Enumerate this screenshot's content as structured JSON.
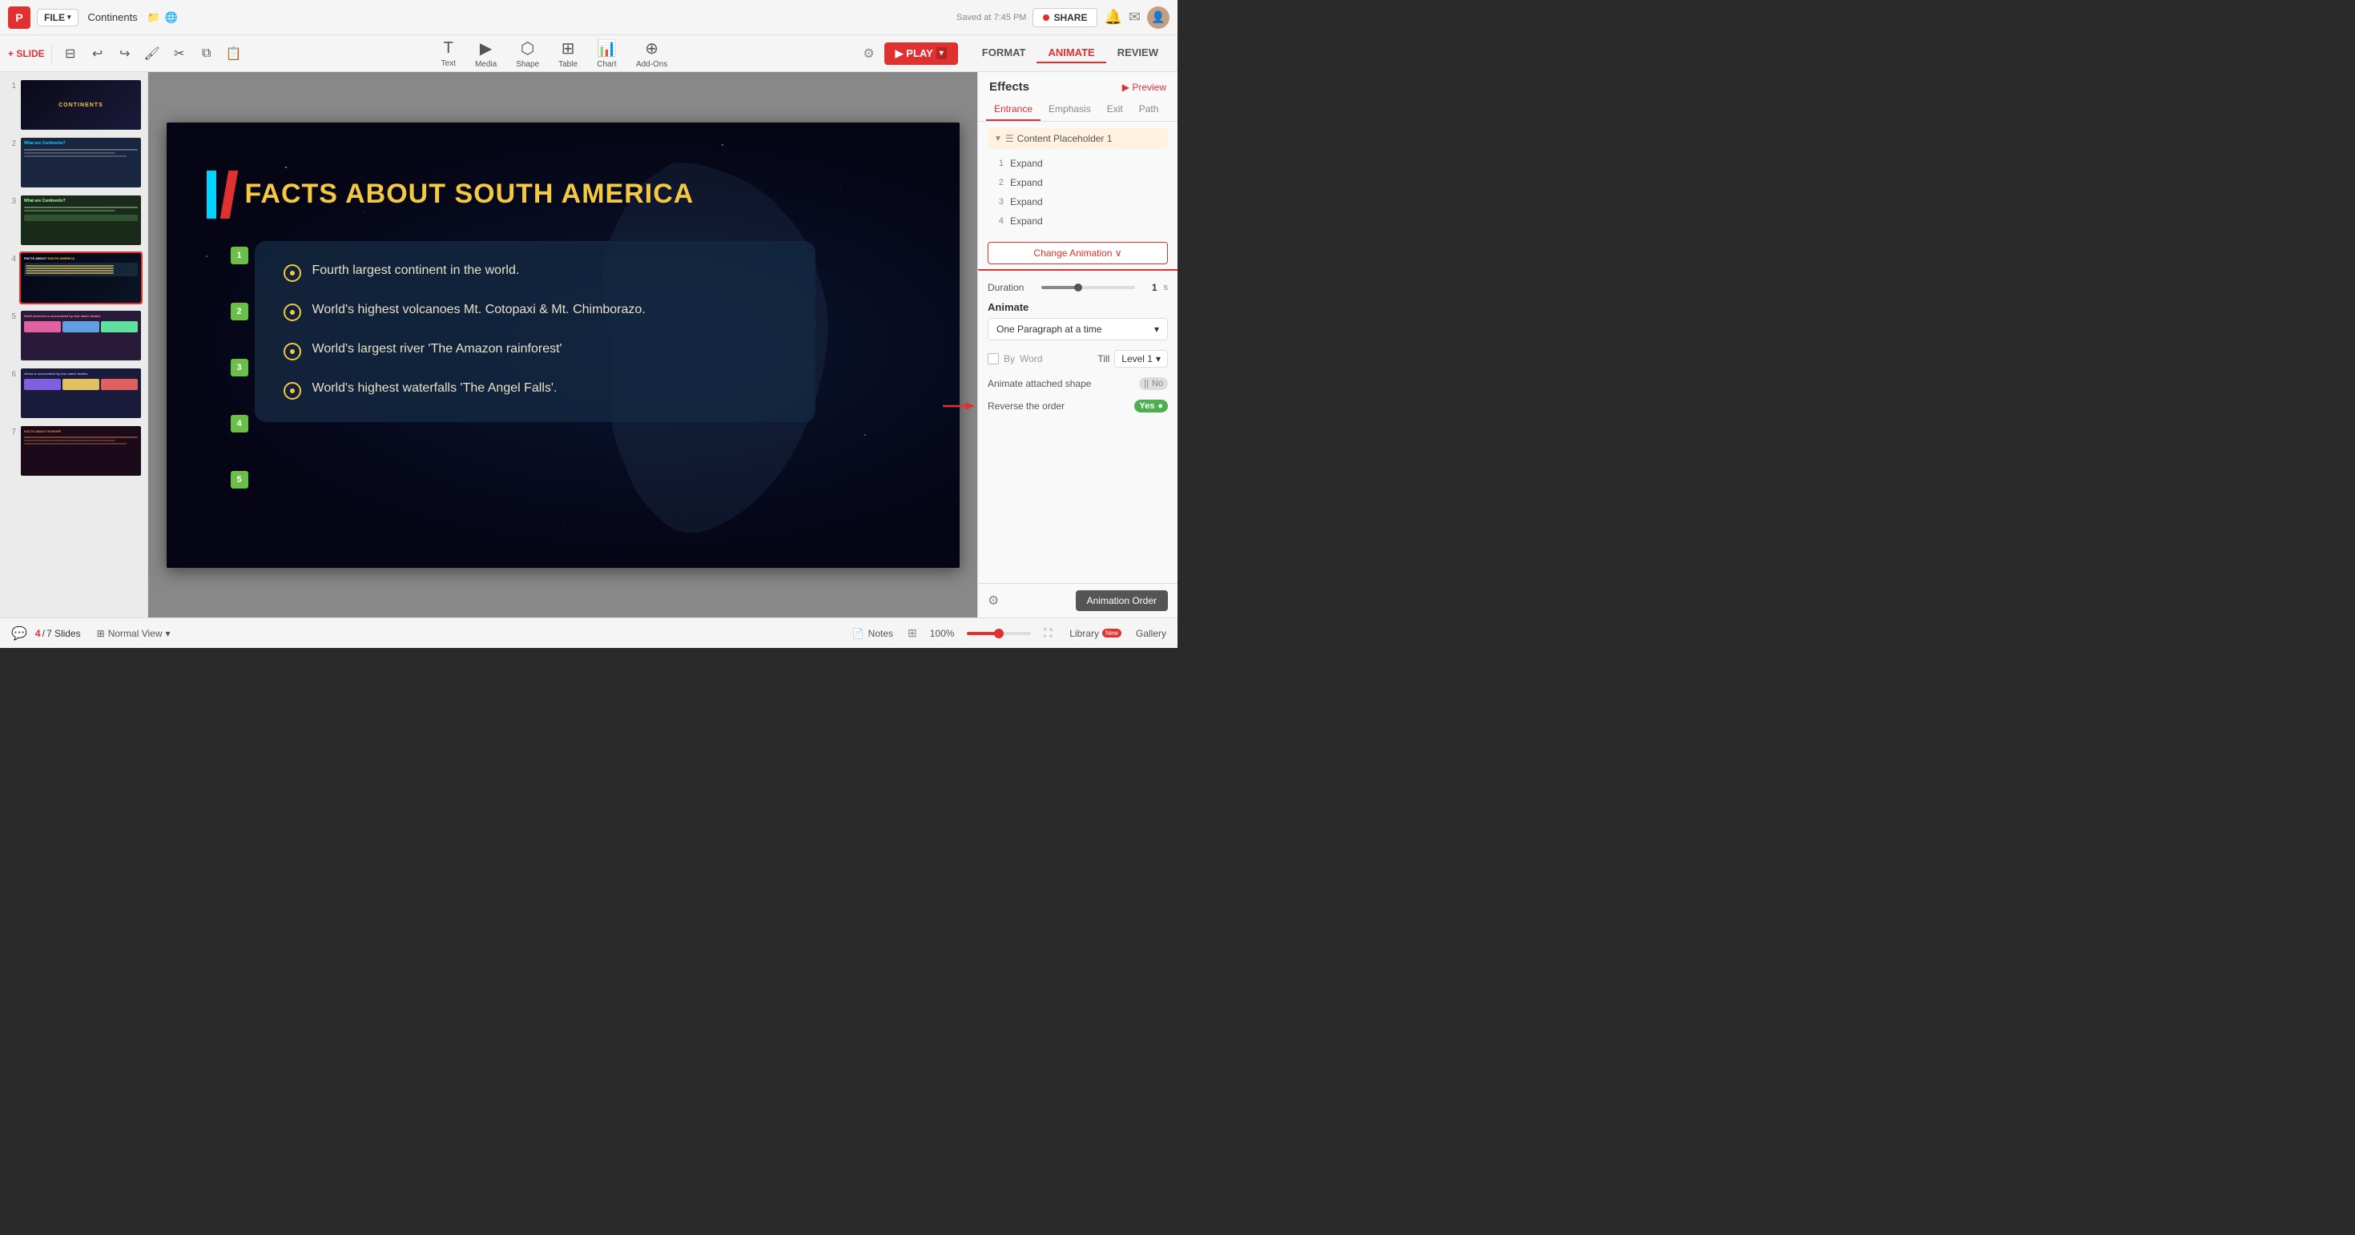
{
  "app": {
    "logo": "P",
    "file_btn": "FILE",
    "doc_title": "Continents",
    "save_status": "Saved at 7:45 PM",
    "share_btn": "SHARE"
  },
  "toolbar": {
    "slide_label": "+ SLIDE",
    "play_btn": "▶ PLAY",
    "tools": [
      {
        "id": "text",
        "icon": "⊞",
        "label": "Text"
      },
      {
        "id": "media",
        "icon": "🎬",
        "label": "Media"
      },
      {
        "id": "shape",
        "icon": "⬡",
        "label": "Shape"
      },
      {
        "id": "table",
        "icon": "⊞",
        "label": "Table"
      },
      {
        "id": "chart",
        "icon": "📊",
        "label": "Chart"
      },
      {
        "id": "addons",
        "icon": "⊕",
        "label": "Add-Ons"
      }
    ],
    "tabs": [
      {
        "id": "format",
        "label": "FORMAT"
      },
      {
        "id": "animate",
        "label": "ANIMATE",
        "active": true
      },
      {
        "id": "review",
        "label": "REVIEW"
      }
    ]
  },
  "slides": [
    {
      "num": 1,
      "type": "title"
    },
    {
      "num": 2,
      "type": "content"
    },
    {
      "num": 3,
      "type": "content"
    },
    {
      "num": 4,
      "type": "facts",
      "active": true
    },
    {
      "num": 5,
      "type": "content"
    },
    {
      "num": 6,
      "type": "content"
    },
    {
      "num": 7,
      "type": "content"
    }
  ],
  "slide": {
    "title_white": "FACTS ABOUT ",
    "title_yellow": "SOUTH AMERICA",
    "facts": [
      "Fourth largest continent in the world.",
      "World's highest volcanoes Mt. Cotopaxi & Mt. Chimborazo.",
      "World's largest river 'The Amazon rainforest'",
      "World's highest waterfalls 'The Angel Falls'."
    ],
    "badge_numbers": [
      "1",
      "2",
      "3",
      "4",
      "5"
    ]
  },
  "animate_panel": {
    "effects_title": "Effects",
    "preview_label": "▶ Preview",
    "tabs": [
      "Entrance",
      "Emphasis",
      "Exit",
      "Path"
    ],
    "active_tab": "Entrance",
    "content_placeholder": "Content Placeholder 1",
    "animations": [
      {
        "num": 1,
        "label": "Expand"
      },
      {
        "num": 2,
        "label": "Expand"
      },
      {
        "num": 3,
        "label": "Expand"
      },
      {
        "num": 4,
        "label": "Expand"
      }
    ],
    "change_animation_btn": "Change Animation ∨",
    "duration_label": "Duration",
    "duration_value": "1",
    "duration_unit": "s",
    "animate_label": "Animate",
    "animate_option": "One Paragraph at a time",
    "by_label": "By",
    "word_label": "Word",
    "till_label": "Till",
    "till_value": "Level 1",
    "attached_shape_label": "Animate attached shape",
    "attached_toggle": "No",
    "reverse_order_label": "Reverse the order",
    "reverse_toggle": "Yes",
    "animation_order_btn": "Animation Order"
  },
  "bottombar": {
    "current_slide": "4",
    "total_slides": "7 Slides",
    "view": "Normal View",
    "notes_label": "Notes",
    "zoom": "100%",
    "library_label": "Library",
    "library_badge": "New",
    "gallery_label": "Gallery"
  }
}
